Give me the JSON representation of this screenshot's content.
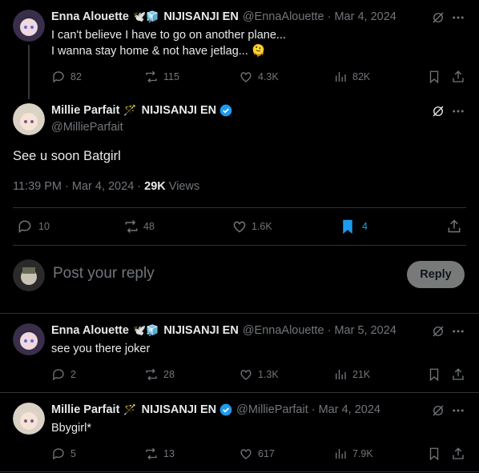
{
  "tweets": [
    {
      "name": "Enna Alouette",
      "emoji": "🕊️🧊",
      "org": "NIJISANJI EN",
      "handle": "@EnnaAlouette",
      "date": "Mar 4, 2024",
      "line1": "I can't believe I have to go on another plane...",
      "line2": "I wanna stay home & not have jetlag... 🫠",
      "replies": "82",
      "reposts": "115",
      "likes": "4.3K",
      "views": "82K"
    },
    {
      "name": "Enna Alouette",
      "emoji": "🕊️🧊",
      "org": "NIJISANJI EN",
      "handle": "@EnnaAlouette",
      "date": "Mar 5, 2024",
      "line1": "see you there joker",
      "replies": "2",
      "reposts": "28",
      "likes": "1.3K",
      "views": "21K"
    },
    {
      "name": "Millie Parfait",
      "emoji": "🪄",
      "org": "NIJISANJI EN",
      "handle": "@MillieParfait",
      "date": "Mar 4, 2024",
      "line1": "Bbygirl*",
      "replies": "5",
      "reposts": "13",
      "likes": "617",
      "views": "7.9K"
    }
  ],
  "main": {
    "name": "Millie Parfait",
    "emoji": "🪄",
    "org": "NIJISANJI EN",
    "handle": "@MillieParfait",
    "text": "See u soon Batgirl",
    "time": "11:39 PM · Mar 4, 2024 · ",
    "views_count": "29K",
    "views_label": " Views",
    "replies": "10",
    "reposts": "48",
    "likes": "1.6K",
    "bookmarks": "4"
  },
  "reply_box": {
    "placeholder": "Post your reply",
    "button": "Reply"
  },
  "colors": {
    "accent": "#1d9bf0",
    "muted": "#71767b",
    "background": "#000000"
  },
  "icons": [
    "reply-icon",
    "repost-icon",
    "like-icon",
    "views-icon",
    "bookmark-icon",
    "share-icon",
    "grok-icon",
    "more-icon",
    "verified-icon"
  ]
}
